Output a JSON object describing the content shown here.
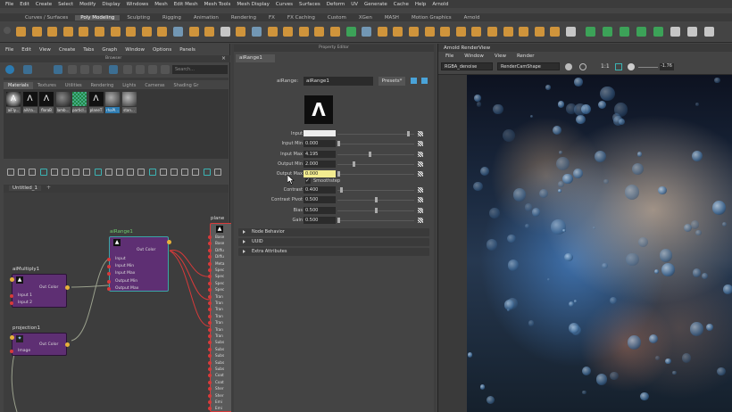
{
  "main_menu": [
    "File",
    "Edit",
    "Create",
    "Select",
    "Modify",
    "Display",
    "Windows",
    "Mesh",
    "Edit Mesh",
    "Mesh Tools",
    "Mesh Display",
    "Curves",
    "Surfaces",
    "Deform",
    "UV",
    "Generate",
    "Cache",
    "Help",
    "Arnold"
  ],
  "shelf_tabs": [
    "Curves / Surfaces",
    "Poly Modeling",
    "Sculpting",
    "Rigging",
    "Animation",
    "Rendering",
    "FX",
    "FX Caching",
    "Custom",
    "XGen",
    "MASH",
    "Motion Graphics",
    "Arnold"
  ],
  "shelf_active": "Poly Modeling",
  "hypershade": {
    "menu": [
      "File",
      "Edit",
      "View",
      "Create",
      "Tabs",
      "Graph",
      "Window",
      "Options",
      "Panels"
    ],
    "browser_label": "Browser",
    "search_placeholder": "Search...",
    "tabs": [
      "Materials",
      "Textures",
      "Utilities",
      "Rendering",
      "Lights",
      "Cameras",
      "Shading Gr"
    ],
    "active_tab": "Materials",
    "swatches": [
      "aiFly...",
      "aiVra...",
      "floraB",
      "lamb...",
      "particl...",
      "planeT",
      "rhaPI...",
      "stan..."
    ],
    "graph_tab": "Untitled_1",
    "nodes": {
      "range": {
        "title": "aiRange1",
        "out": "Out Color",
        "inputs": [
          "Input",
          "Input Min",
          "Input Max",
          "Output Min",
          "Output Max"
        ]
      },
      "multiply": {
        "title": "aiMultiply1",
        "out": "Out Color",
        "inputs": [
          "Input 1",
          "Input 2"
        ]
      },
      "projection": {
        "title": "projection1",
        "out": "Out Color",
        "inputs": [
          "Image"
        ]
      },
      "plane": {
        "title": "plane",
        "rows": [
          "Base",
          "Base",
          "Diffu",
          "Diffu",
          "Meta",
          "Spec",
          "Spec",
          "Spec",
          "Spec",
          "Tran",
          "Tran",
          "Tran",
          "Tran",
          "Tran",
          "Tran",
          "Tran",
          "Subs",
          "Subs",
          "Subs",
          "Subs",
          "Subs",
          "Coat",
          "Coat",
          "Sher",
          "Sher",
          "Emi",
          "Emi"
        ]
      }
    }
  },
  "property_editor": {
    "header": "Property Editor",
    "tab": "aiRange1",
    "node_label": "aiRange:",
    "node_value": "aiRange1",
    "presets": "Presets*",
    "attributes": [
      {
        "label": "Input",
        "value": "",
        "slider": 0.93,
        "type": "color"
      },
      {
        "label": "Input Min",
        "value": "0.000",
        "slider": 0.0
      },
      {
        "label": "Input Max",
        "value": "4.195",
        "slider": 0.42
      },
      {
        "label": "Output Min",
        "value": "2.000",
        "slider": 0.2
      },
      {
        "label": "Output Max",
        "value": "0.000",
        "slider": 0.0,
        "highlight": true
      }
    ],
    "smoothstep_label": "Smoothstep",
    "smoothstep_checked": true,
    "attributes2": [
      {
        "label": "Contrast",
        "value": "0.400",
        "slider": 0.04
      },
      {
        "label": "Contrast Pivot",
        "value": "0.500",
        "slider": 0.5
      },
      {
        "label": "Bias",
        "value": "0.500",
        "slider": 0.5
      },
      {
        "label": "Gain",
        "value": "0.500",
        "slider": 0.0
      }
    ],
    "sections": [
      "Node Behavior",
      "UUID",
      "Extra Attributes"
    ]
  },
  "render_view": {
    "title": "Arnold RenderView",
    "menu": [
      "File",
      "Window",
      "View",
      "Render"
    ],
    "aov": "RGBA_denoise",
    "camera": "RenderCamShape",
    "zoom": "1:1",
    "exposure": "-1.76"
  },
  "colors": {
    "node_purple": "#5e2f73",
    "node_selected": "#3aa6a6",
    "port_yellow": "#e8b13a",
    "port_red": "#d83a3a",
    "shelf_yellow": "#e8a23a",
    "shelf_green": "#3bb35c"
  }
}
